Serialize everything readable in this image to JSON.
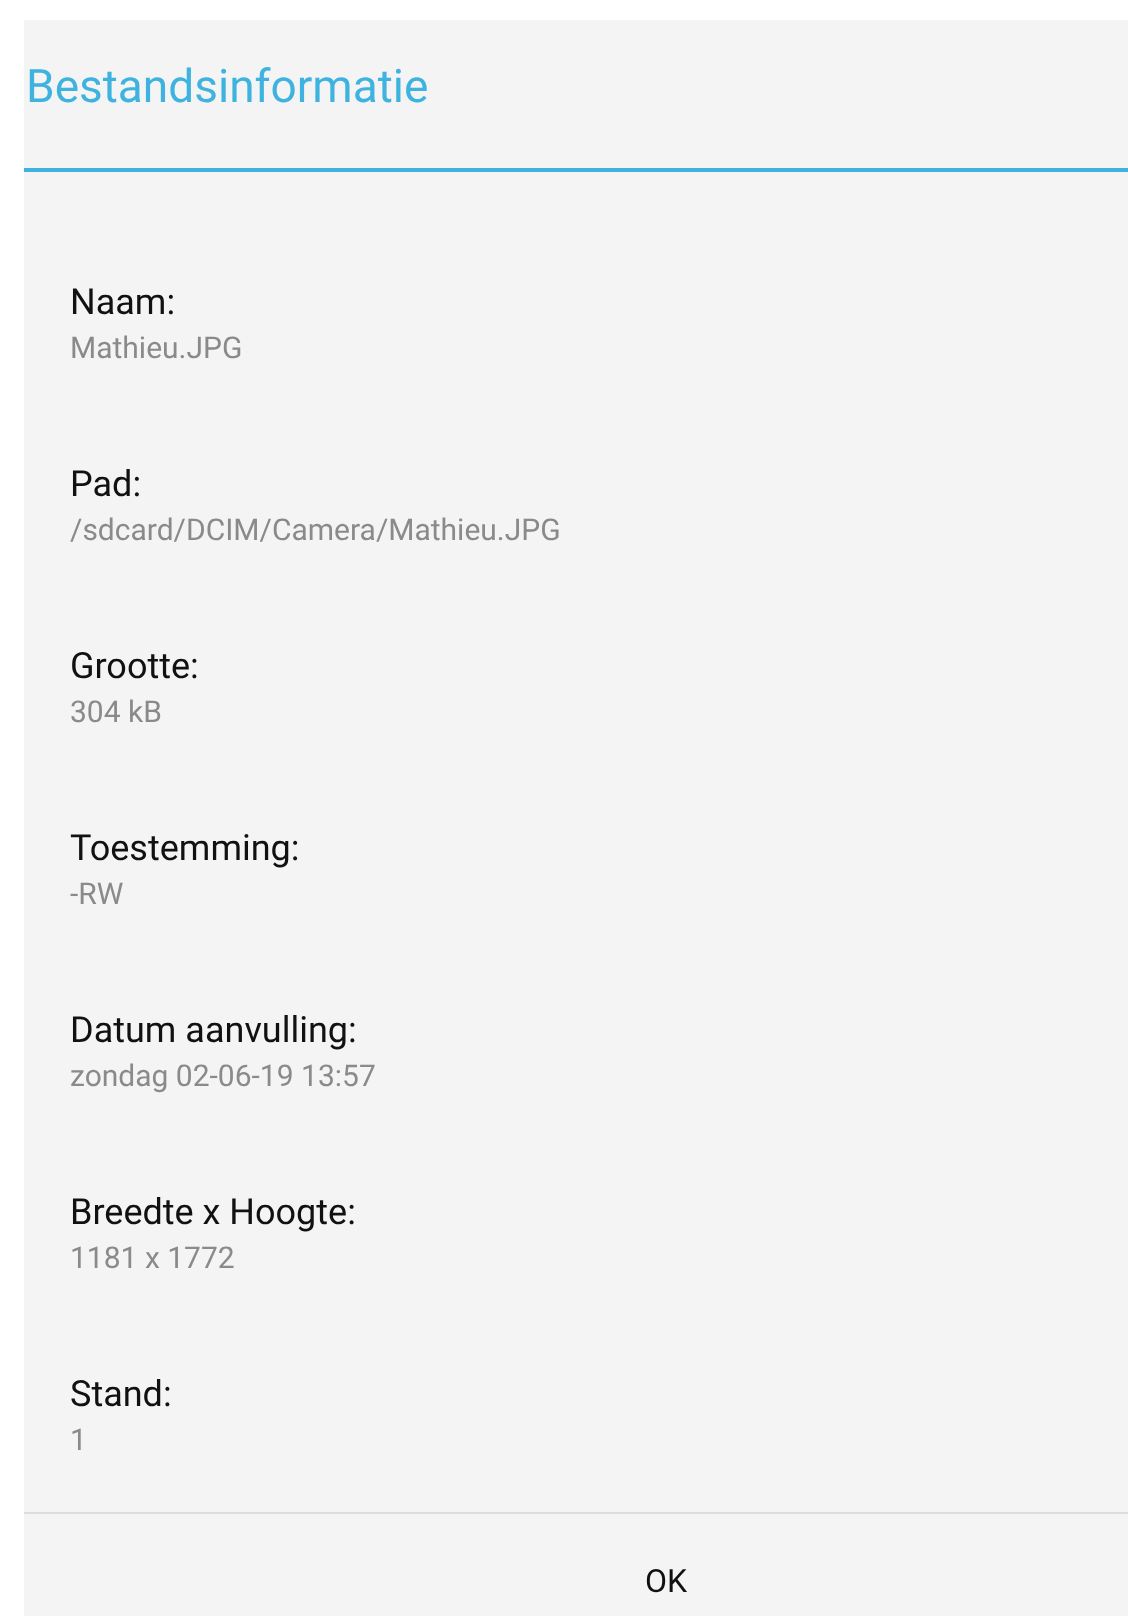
{
  "dialog": {
    "title": "Bestandsinformatie",
    "fields": [
      {
        "label": "Naam:",
        "value": "Mathieu.JPG"
      },
      {
        "label": "Pad:",
        "value": "/sdcard/DCIM/Camera/Mathieu.JPG"
      },
      {
        "label": "Grootte:",
        "value": "304 kB"
      },
      {
        "label": "Toestemming:",
        "value": "-RW"
      },
      {
        "label": "Datum aanvulling:",
        "value": "zondag 02-06-19 13:57"
      },
      {
        "label": "Breedte x Hoogte:",
        "value": "1181 x 1772"
      },
      {
        "label": "Stand:",
        "value": "1"
      }
    ],
    "buttons": [
      "OK"
    ]
  }
}
